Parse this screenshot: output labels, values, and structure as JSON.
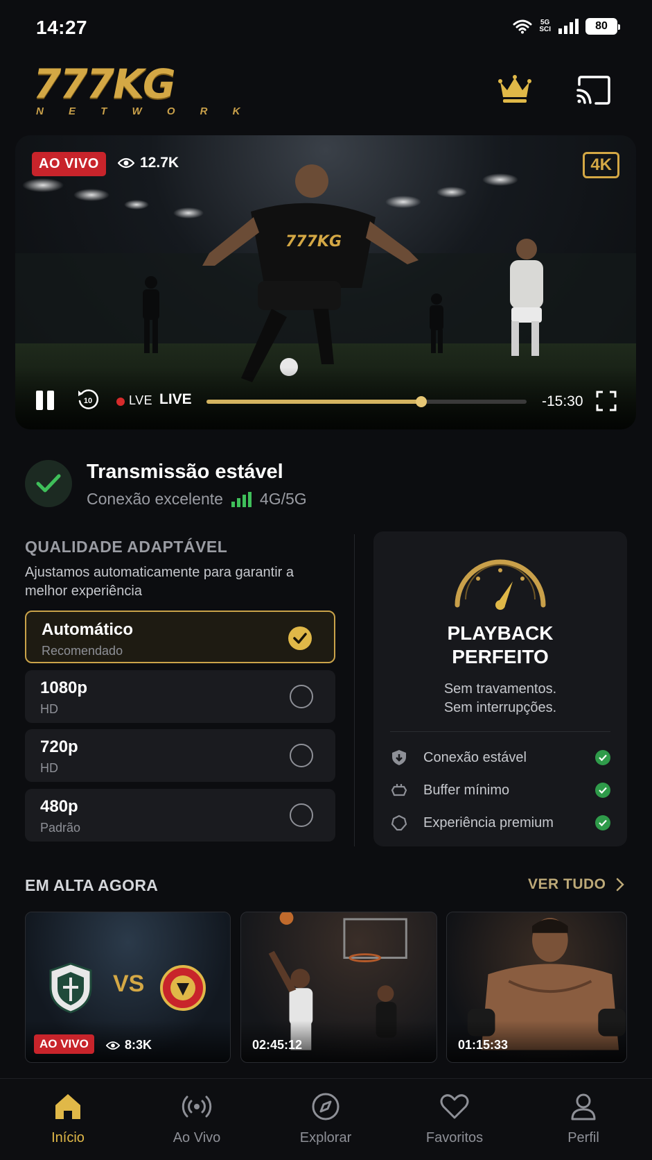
{
  "status_bar": {
    "time": "14:27",
    "network": "5G",
    "network_sub": "SCI",
    "battery": "80"
  },
  "header": {
    "logo": "777KG",
    "logo_sub": "N E T W O R K"
  },
  "player": {
    "live_badge": "AO VIVO",
    "viewers": "12.7K",
    "quality_badge": "4K",
    "live_small": "LVE",
    "live_label": "LIVE",
    "time_left": "-15:30",
    "progress": 0.67
  },
  "connection": {
    "title": "Transmissão estável",
    "subtitle": "Conexão excelente",
    "network": "4G/5G"
  },
  "quality": {
    "title": "QUALIDADE ADAPTÁVEL",
    "description": "Ajustamos automaticamente para garantir a melhor experiência",
    "options": [
      {
        "label": "Automático",
        "sub": "Recomendado",
        "selected": true
      },
      {
        "label": "1080p",
        "sub": "HD",
        "selected": false
      },
      {
        "label": "720p",
        "sub": "HD",
        "selected": false
      },
      {
        "label": "480p",
        "sub": "Padrão",
        "selected": false
      }
    ]
  },
  "playback": {
    "title_line1": "PLAYBACK",
    "title_line2": "PERFEITO",
    "desc_line1": "Sem travamentos.",
    "desc_line2": "Sem interrupções.",
    "features": [
      {
        "label": "Conexão estável"
      },
      {
        "label": "Buffer mínimo"
      },
      {
        "label": "Experiência premium"
      }
    ]
  },
  "trending": {
    "title": "EM ALTA AGORA",
    "see_all": "VER TUDO",
    "cards": [
      {
        "badge": "AO VIVO",
        "viewers": "8:3K",
        "vs": "VS"
      },
      {
        "time": "02:45:12"
      },
      {
        "time": "01:15:33"
      }
    ]
  },
  "nav": {
    "items": [
      {
        "label": "Início",
        "icon": "home-icon",
        "active": true
      },
      {
        "label": "Ao Vivo",
        "icon": "broadcast-icon",
        "active": false
      },
      {
        "label": "Explorar",
        "icon": "compass-icon",
        "active": false
      },
      {
        "label": "Favoritos",
        "icon": "heart-icon",
        "active": false
      },
      {
        "label": "Perfil",
        "icon": "user-icon",
        "active": false
      }
    ]
  },
  "colors": {
    "accent": "#e0b848",
    "live": "#c8242b",
    "success": "#3fbf5a"
  }
}
